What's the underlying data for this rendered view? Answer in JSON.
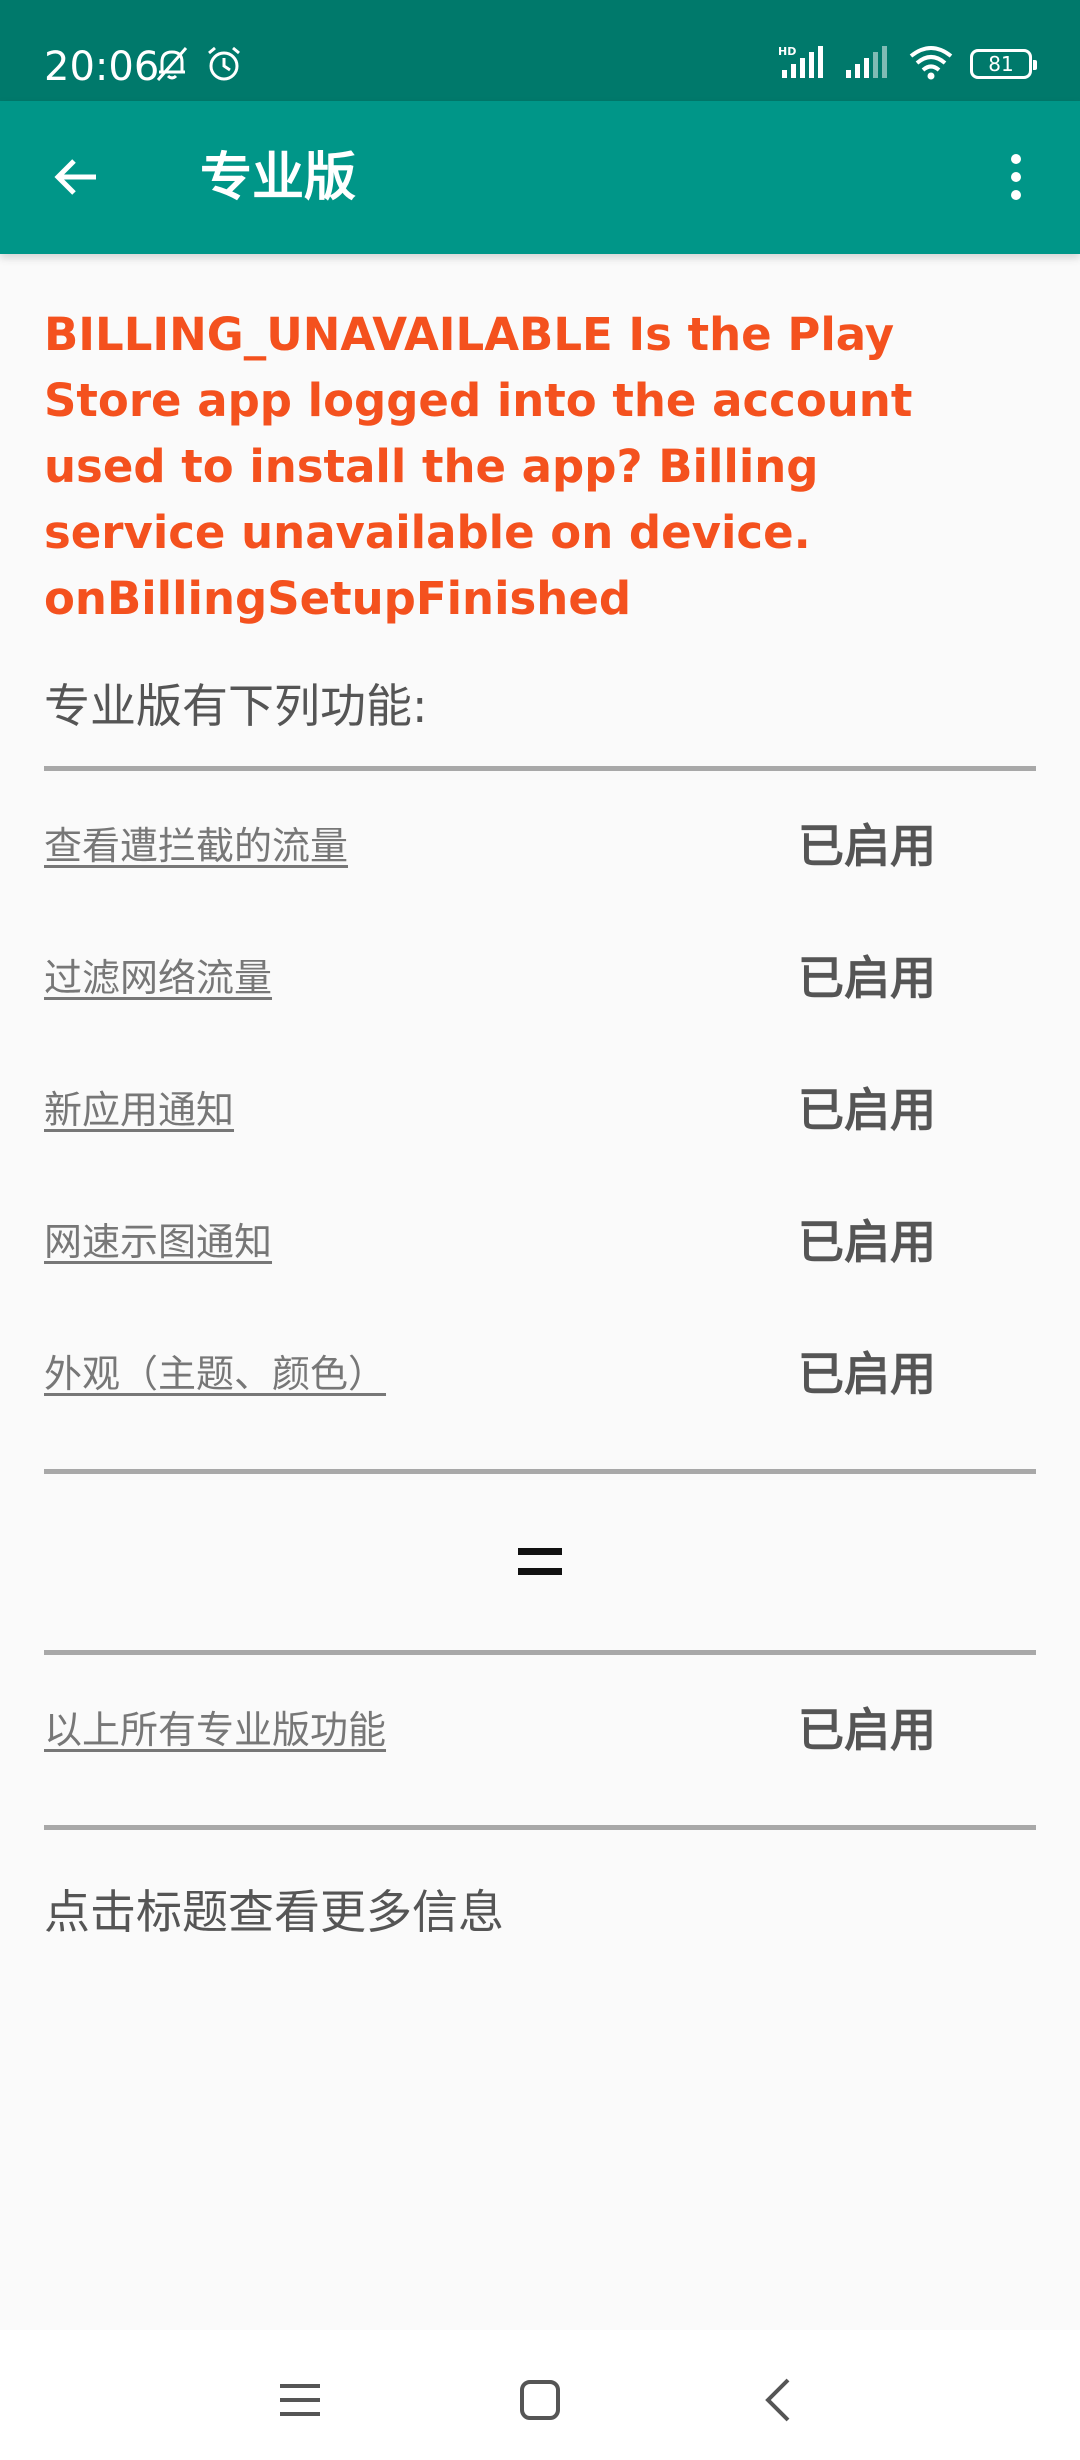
{
  "status_bar": {
    "time": "20:06",
    "battery": "81",
    "icons": [
      "mute-bell-icon",
      "alarm-icon",
      "hd-signal-icon",
      "signal-icon",
      "wifi-icon",
      "battery-icon"
    ]
  },
  "toolbar": {
    "title": "专业版",
    "back_icon": "back-arrow-icon",
    "menu_icon": "more-vert-icon"
  },
  "error_message": "BILLING_UNAVAILABLE Is the Play Store app logged into the account used to install the app? Billing service unavailable on device. onBillingSetupFinished",
  "intro": "专业版有下列功能:",
  "features": [
    {
      "label": "查看遭拦截的流量",
      "status": "已启用"
    },
    {
      "label": "过滤网络流量",
      "status": "已启用"
    },
    {
      "label": "新应用通知",
      "status": "已启用"
    },
    {
      "label": "网速示图通知",
      "status": "已启用"
    },
    {
      "label": "外观（主题、颜色）",
      "status": "已启用"
    }
  ],
  "all_features": {
    "label": "以上所有专业版功能",
    "status": "已启用"
  },
  "footer_note": "点击标题查看更多信息",
  "nav": {
    "recents_icon": "menu-lines-icon",
    "home_icon": "home-square-icon",
    "back_icon": "back-chevron-icon"
  },
  "colors": {
    "status_bar": "#00796b",
    "toolbar": "#009688",
    "error": "#f4511e",
    "background": "#fafafa"
  }
}
